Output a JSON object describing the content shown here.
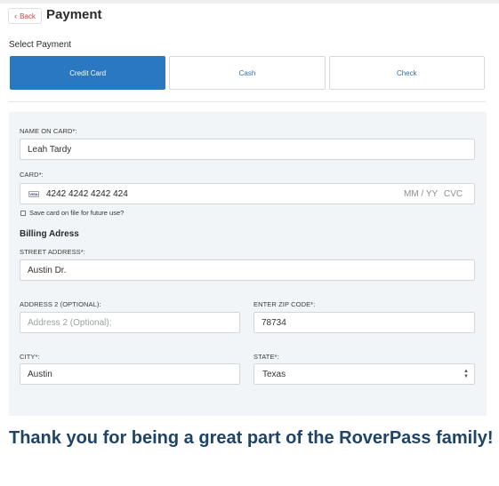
{
  "header": {
    "back_label": "Back",
    "title": "Payment"
  },
  "payment": {
    "section_label": "Select Payment",
    "tabs": [
      {
        "label": "Credit Card",
        "active": true
      },
      {
        "label": "Cash",
        "active": false
      },
      {
        "label": "Check",
        "active": false
      }
    ]
  },
  "form": {
    "name_label": "NAME ON CARD*:",
    "name_value": "Leah Tardy",
    "card_label": "CARD*:",
    "card_brand": "VISA",
    "card_number": "4242 4242 4242 424",
    "card_exp_placeholder": "MM / YY",
    "card_cvc_placeholder": "CVC",
    "save_card_label": "Save card on file for future use?",
    "billing_title": "Billing Adress",
    "street_label": "STREET ADDRESS*:",
    "street_value": "Austin Dr.",
    "address2_label": "ADDRESS 2 (OPTIONAL):",
    "address2_placeholder": "Address 2 (Optional):",
    "zip_label": "ENTER ZIP CODE*:",
    "zip_value": "78734",
    "city_label": "CITY*:",
    "city_value": "Austin",
    "state_label": "STATE*:",
    "state_value": "Texas"
  },
  "footer": {
    "thanks": "Thank you for being a great part of the RoverPass family!"
  },
  "colors": {
    "accent": "#2a78c2",
    "back_text": "#d2423a",
    "thanks_text": "#1f4468",
    "panel_bg": "#f2f5f8"
  }
}
